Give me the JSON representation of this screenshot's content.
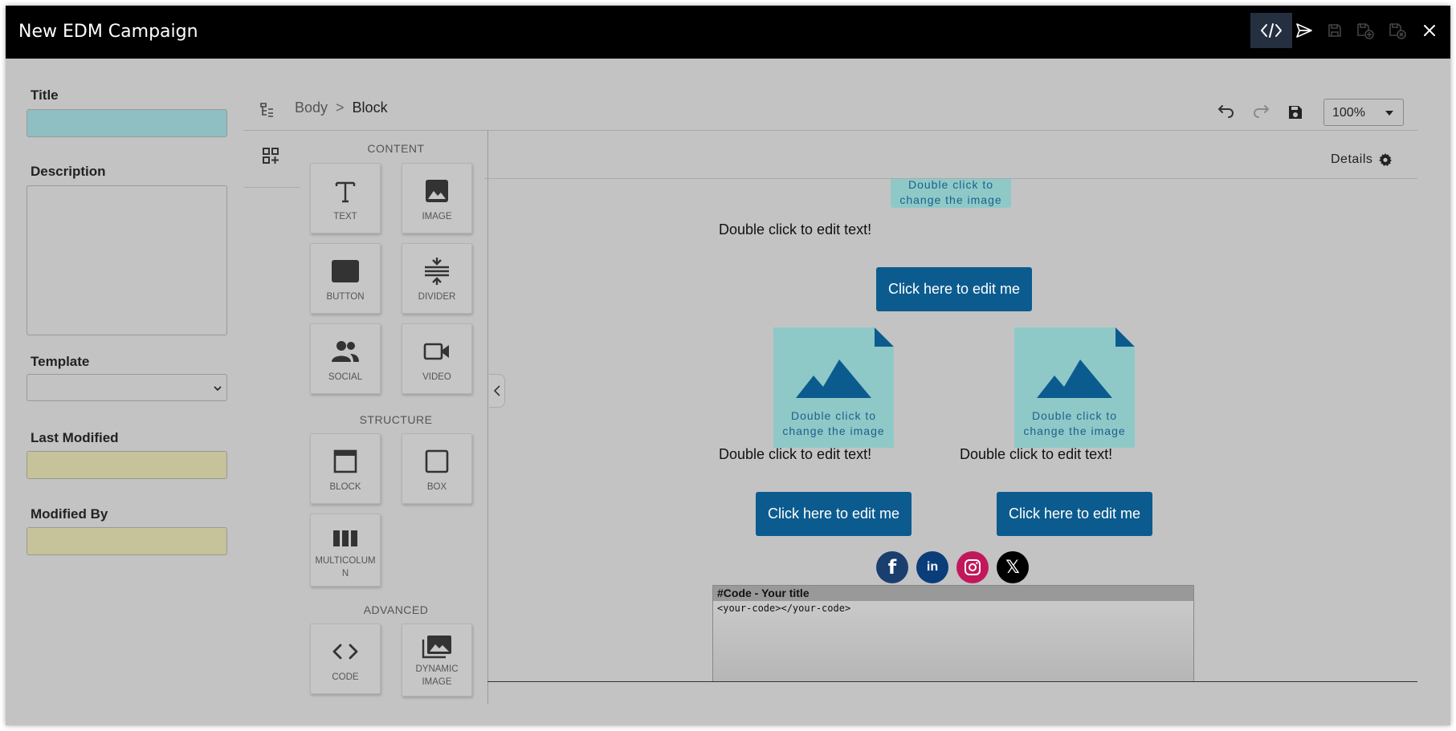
{
  "window": {
    "title": "New EDM Campaign",
    "toolbar_icons": [
      "code-icon",
      "send-icon",
      "save-icon",
      "save-add-icon",
      "save-close-icon",
      "close-icon"
    ]
  },
  "form": {
    "title_label": "Title",
    "title_value": "",
    "description_label": "Description",
    "description_value": "",
    "template_label": "Template",
    "template_value": "",
    "last_modified_label": "Last Modified",
    "last_modified_value": "",
    "modified_by_label": "Modified By",
    "modified_by_value": ""
  },
  "editor": {
    "breadcrumb": [
      "Body",
      ">",
      "Block"
    ],
    "zoom": "100%",
    "details_label": "Details"
  },
  "blocks_panel": {
    "content_heading": "CONTENT",
    "structure_heading": "STRUCTURE",
    "advanced_heading": "ADVANCED",
    "content_items": [
      {
        "label": "TEXT",
        "icon": "text-icon"
      },
      {
        "label": "IMAGE",
        "icon": "image-icon"
      },
      {
        "label": "BUTTON",
        "icon": "button-icon"
      },
      {
        "label": "DIVIDER",
        "icon": "divider-icon"
      },
      {
        "label": "SOCIAL",
        "icon": "social-icon"
      },
      {
        "label": "VIDEO",
        "icon": "video-icon"
      }
    ],
    "structure_items": [
      {
        "label": "BLOCK",
        "icon": "block-icon"
      },
      {
        "label": "BOX",
        "icon": "box-icon"
      },
      {
        "label": "MULTICOLUMN",
        "icon": "multicolumn-icon",
        "display_lines": [
          "MULTICOLUM",
          "N"
        ]
      }
    ],
    "advanced_items": [
      {
        "label": "CODE",
        "icon": "code-icon"
      },
      {
        "label": "DYNAMIC IMAGE",
        "icon": "dynamic-image-icon",
        "display_lines": [
          "DYNAMIC",
          "IMAGE"
        ]
      }
    ]
  },
  "canvas": {
    "image_placeholder_text": [
      "Double click to",
      "change the image"
    ],
    "text_placeholder": "Double click to edit text!",
    "button_text": "Click here to edit me",
    "social_networks": [
      "facebook",
      "linkedin",
      "instagram",
      "x"
    ],
    "social_glyphs": {
      "facebook": "f",
      "linkedin": "in",
      "x": "𝕏"
    },
    "social_colors": {
      "facebook": "#1a3f6e",
      "linkedin": "#0a3d7a",
      "instagram": "#c2185b",
      "x": "#000000"
    },
    "code_block": {
      "title": "#Code - Your title",
      "body": "<your-code></your-code>"
    }
  },
  "colors": {
    "image_placeholder": "#8ec9c8",
    "button": "#0c5b8f",
    "title_field": "#8fbfc3",
    "readonly_field": "#c6c29a"
  }
}
